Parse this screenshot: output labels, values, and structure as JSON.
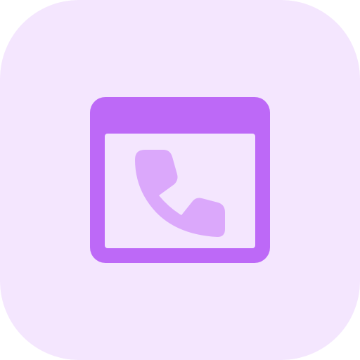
{
  "icon": {
    "name": "browser-window-phone-icon",
    "parts": [
      "browser-window-icon",
      "phone-handset-icon"
    ]
  },
  "colors": {
    "tile_background": "#F4E6FE",
    "window_frame": "#BD69F7",
    "window_content": "#F4E6FE",
    "handset": "#DBA8FB"
  }
}
